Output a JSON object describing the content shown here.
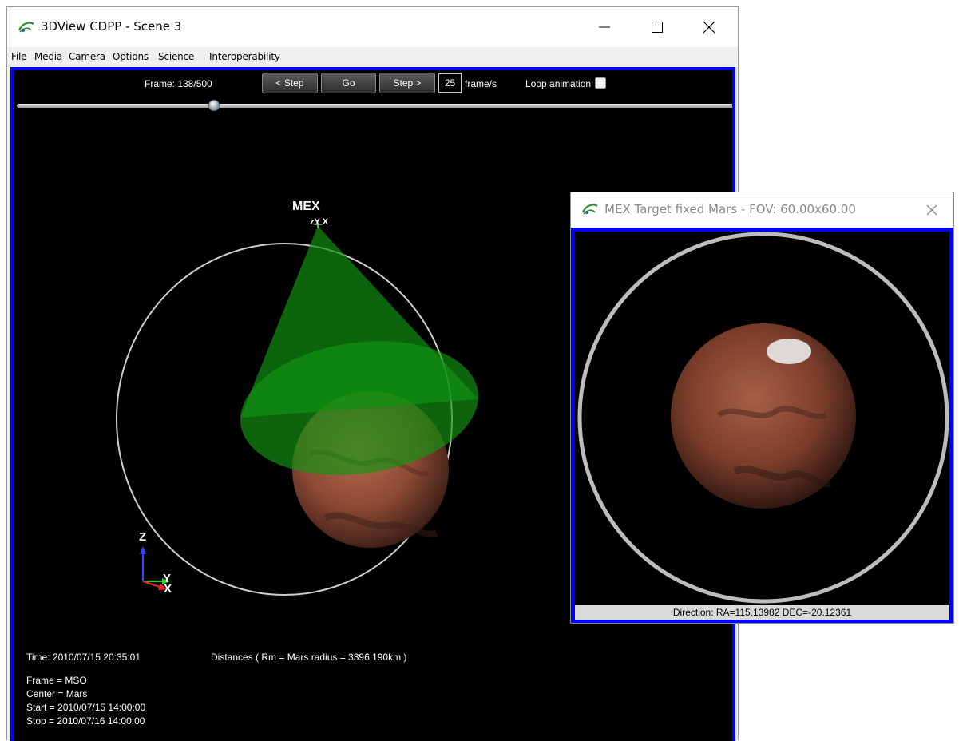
{
  "main_window": {
    "title": "3DView CDPP - Scene 3",
    "menu": [
      "File",
      "Media",
      "Camera",
      "Options",
      "Science",
      "Interoperability"
    ],
    "toolbar": {
      "frame_label": "Frame: 138/500",
      "step_back_label": "< Step",
      "go_label": "Go",
      "step_forward_label": "Step >",
      "fps_value": "25",
      "fps_unit": "frame/s",
      "loop_label": "Loop animation",
      "loop_checked": false,
      "frame_current": 138,
      "frame_total": 500
    },
    "scene": {
      "spacecraft_label": "MEX",
      "spacecraft_axes": "zY X",
      "axis_z": "Z",
      "axis_y": "Y",
      "axis_x": "X",
      "time_text": "Time: 2010/07/15 20:35:01",
      "distances_text": "Distances ( Rm = Mars radius = 3396.190km )",
      "frame_text": "Frame = MSO",
      "center_text": "Center = Mars",
      "start_text": "Start = 2010/07/15 14:00:00",
      "stop_text": "Stop = 2010/07/16 14:00:00"
    }
  },
  "fov_window": {
    "title": "MEX Target fixed Mars -  FOV: 60.00x60.00",
    "status": "Direction: RA=115.13982 DEC=-20.12361"
  },
  "colors": {
    "frame_blue": "#0000ff",
    "cone_green": "#118a11",
    "mars_red": "#a0523c",
    "orbit_gray": "#c8c8c8"
  }
}
